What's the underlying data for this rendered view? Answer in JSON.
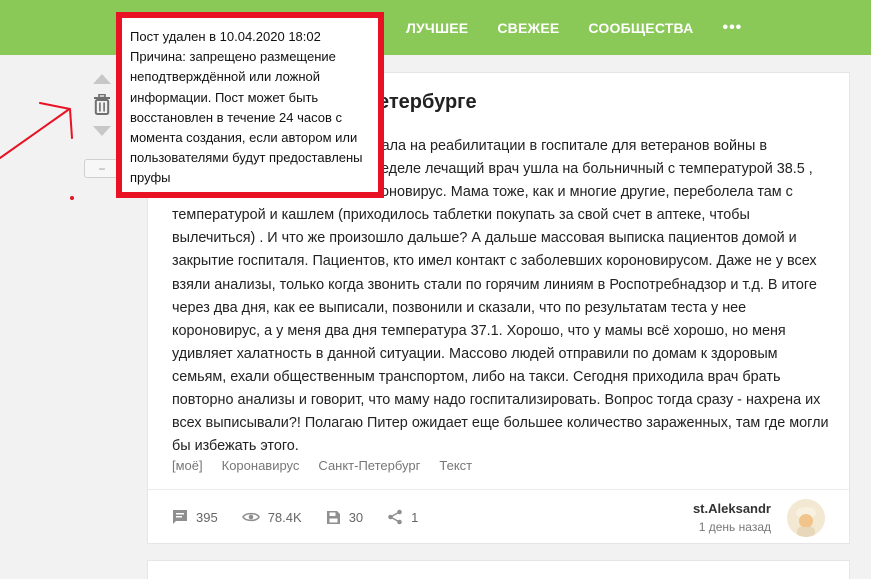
{
  "nav": {
    "items": [
      "ЛУЧШЕЕ",
      "СВЕЖЕЕ",
      "СООБЩЕСТВА"
    ],
    "more": "•••"
  },
  "vote": {
    "minus_label": "−"
  },
  "notice": {
    "lines": [
      "Пост удален в 10.04.2020 18:02",
      "Причина: запрещено размещение",
      "неподтверждённой или ложной",
      "информации. Пост может быть",
      "восстановлен в течение 24 часов с",
      "момента создания, если автором или",
      "пользователями будут предоставлены",
      "пруфы"
    ]
  },
  "post": {
    "title_visible": "етербурге",
    "body_lines": [
      "жала на реабилитации в госпитале для ветеранов войны в",
      "еделе лечащий врач ушла на больничный с температурой 38.5 ,",
      "оновирус. Мама тоже, как и многие другие, переболела там с",
      "температурой и кашлем (приходилось таблетки покупать за свой счет в аптеке, чтобы",
      "вылечиться) . И что же произошло дальше? А дальше массовая выписка пациентов домой и",
      "закрытие госпиталя. Пациентов, кто имел контакт с заболевших короновирусом. Даже не у всех",
      "взяли анализы, только когда звонить стали по горячим линиям в Роспотребнадзор и т.д. В итоге",
      "через два дня, как ее выписали, позвонили и сказали, что по результатам теста у нее",
      "короновирус, а у меня два дня температура 37.1. Хорошо, что у мамы всё хорошо, но меня",
      "удивляет халатность в данной ситуации. Массово людей отправили по домам к здоровым",
      "семьям, ехали общественным транспортом, либо на такси. Сегодня приходила врач брать",
      "повторно анализы и говорит, что маму надо госпитализировать. Вопрос тогда сразу - нахрена их",
      "всех выписывали?! Полагаю Питер ожидает еще большее количество зараженных, там где могли",
      "бы избежать этого."
    ],
    "tags": [
      "[моё]",
      "Коронавирус",
      "Санкт-Петербург",
      "Текст"
    ],
    "stats": {
      "comments": "395",
      "views": "78.4K",
      "saves": "30",
      "shares": "1"
    },
    "author": "st.Aleksandr",
    "time": "1 день назад"
  },
  "colors": {
    "header": "#8ac858",
    "notice_border": "#e81224",
    "annotation_arrow": "#e81224"
  }
}
